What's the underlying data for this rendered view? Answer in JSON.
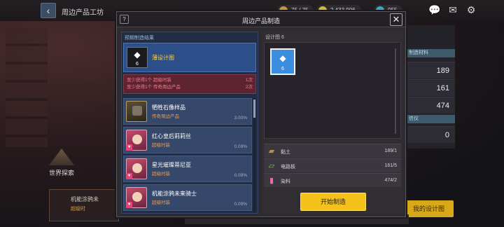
{
  "background": {
    "title": "周边产品工坊",
    "resources": [
      "75 / 75",
      "2,433,996",
      "955"
    ],
    "right_values": [
      "189",
      "161",
      "474",
      "0"
    ],
    "right_tags": [
      "制造材料",
      "信仪"
    ],
    "right_button": "我的设计图",
    "explore_label": "世界探索",
    "bottom_left_title": "机能涂鸦未",
    "bottom_left_sub": "超级时"
  },
  "modal": {
    "title": "周边产品制造",
    "help_label": "?",
    "close_label": "✕",
    "left": {
      "header": "预期制造结果",
      "preview": {
        "name": "薄设计图",
        "count": "6"
      },
      "bonuses": [
        {
          "text": "至少获得1个 超级时装",
          "times": "1次"
        },
        {
          "text": "至少获得1个 传奇周边产品",
          "times": "2次"
        }
      ],
      "items": [
        {
          "name": "牺牲石像样品",
          "category": "传奇周边产品",
          "percent": "3.00%"
        },
        {
          "name": "红心皇后莉莉丝",
          "category": "超级时装",
          "percent": "0.09%"
        },
        {
          "name": "星光璀璨蒂尼亚",
          "category": "超级时装",
          "percent": "0.09%"
        },
        {
          "name": "机能涂鸦未来骑士",
          "category": "超级时装",
          "percent": "0.09%"
        }
      ]
    },
    "right": {
      "header": "设计图 6",
      "blueprint_count": "6",
      "materials": [
        {
          "name": "黏土",
          "qty": "189/1",
          "icon": "clay-icon"
        },
        {
          "name": "电路板",
          "qty": "161/5",
          "icon": "circuit-board-icon"
        },
        {
          "name": "染料",
          "qty": "474/2",
          "icon": "dye-icon"
        }
      ],
      "start_label": "开始制造"
    }
  }
}
